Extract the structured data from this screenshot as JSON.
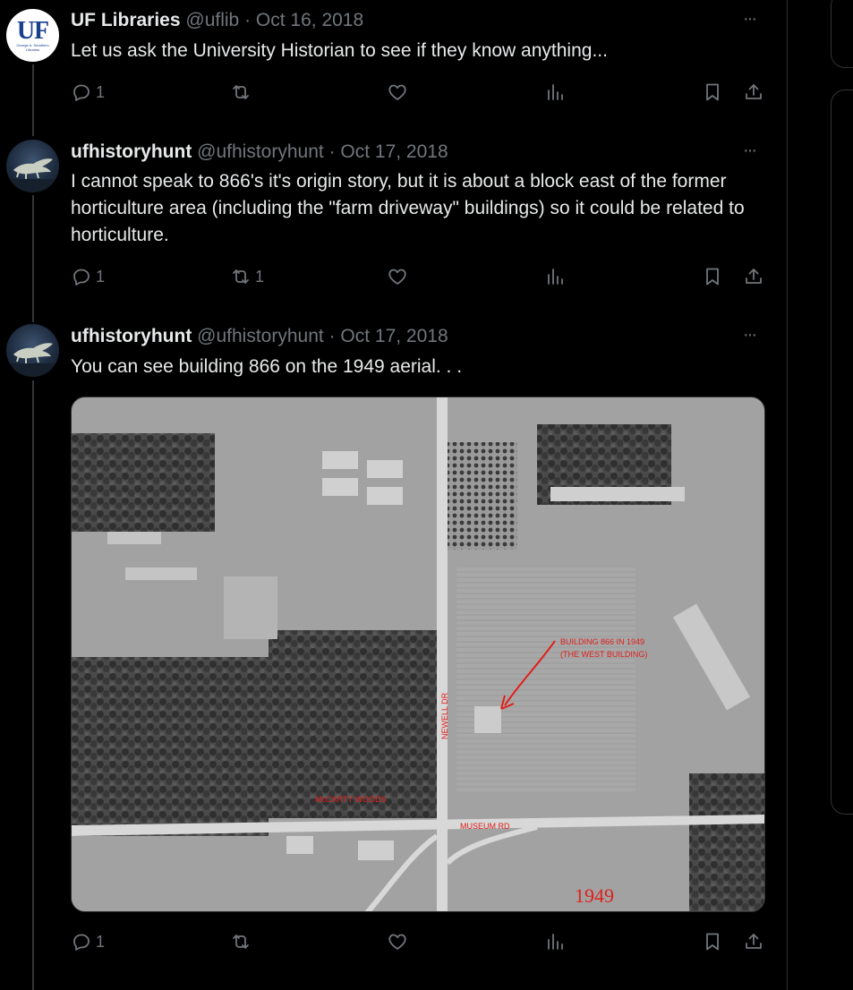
{
  "tweets": [
    {
      "display_name": "UF Libraries",
      "handle": "@uflib",
      "separator": "·",
      "date": "Oct 16, 2018",
      "text": "Let us ask the University Historian to see if they know anything...",
      "avatar_text": "UF",
      "avatar_subtext": "George A. Smathers Libraries",
      "replies": "1",
      "retweets": "",
      "likes": "",
      "more": "···"
    },
    {
      "display_name": "ufhistoryhunt",
      "handle": "@ufhistoryhunt",
      "separator": "·",
      "date": "Oct 17, 2018",
      "text": "I cannot speak to 866's it's origin story,  but it is about a block east of the former horticulture area (including the \"farm driveway\" buildings) so it could be related to horticulture.",
      "replies": "1",
      "retweets": "1",
      "likes": "",
      "more": "···"
    },
    {
      "display_name": "ufhistoryhunt",
      "handle": "@ufhistoryhunt",
      "separator": "·",
      "date": "Oct 17, 2018",
      "text": "You can see building 866 on the 1949 aerial. . .",
      "replies": "1",
      "retweets": "",
      "likes": "",
      "more": "···"
    }
  ],
  "media": {
    "annotations": {
      "building_line1": "BUILDING 866 IN 1949",
      "building_line2": "(THE WEST BUILDING)",
      "newell": "NEWELL DR",
      "mccarty": "McCARTY WOODS",
      "museum": "MUSEUM RD",
      "year": "1949"
    },
    "annotation_color": "#e0201c"
  },
  "icons": [
    "reply-icon",
    "retweet-icon",
    "like-icon",
    "views-icon",
    "bookmark-icon",
    "share-icon"
  ]
}
